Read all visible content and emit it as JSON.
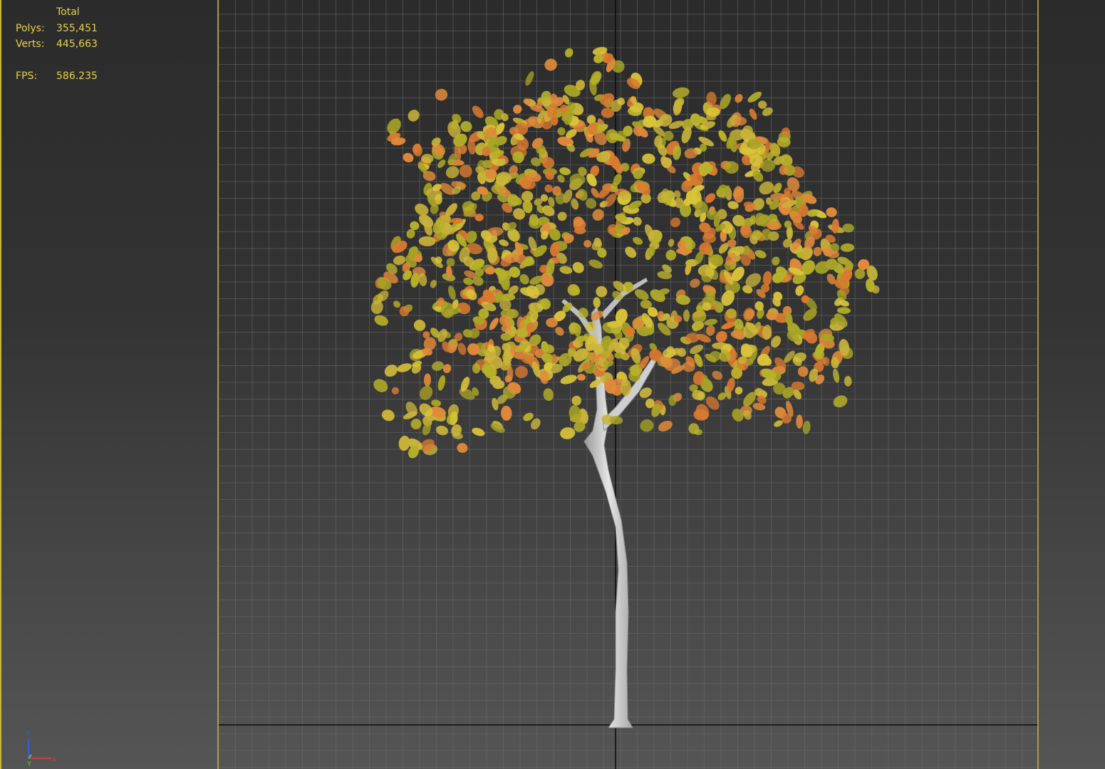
{
  "stats": {
    "header": "Total",
    "polys_label": "Polys:",
    "polys_value": "355,451",
    "verts_label": "Verts:",
    "verts_value": "445,663",
    "fps_label": "FPS:",
    "fps_value": "586.235"
  },
  "axis_tripod": {
    "z_label": "z",
    "y_label": "Y",
    "x_label": "x"
  },
  "colors": {
    "stats_text": "#e8d44a",
    "viewport_border": "#c9b43a",
    "grid_line": "#6a6a6a",
    "leaf_green": "#b7b12a",
    "leaf_yellow": "#d8c33a",
    "leaf_orange": "#e08a3a",
    "trunk": "#d8d8d8"
  },
  "viewport": {
    "view": "front",
    "content": "autumn tree model"
  }
}
